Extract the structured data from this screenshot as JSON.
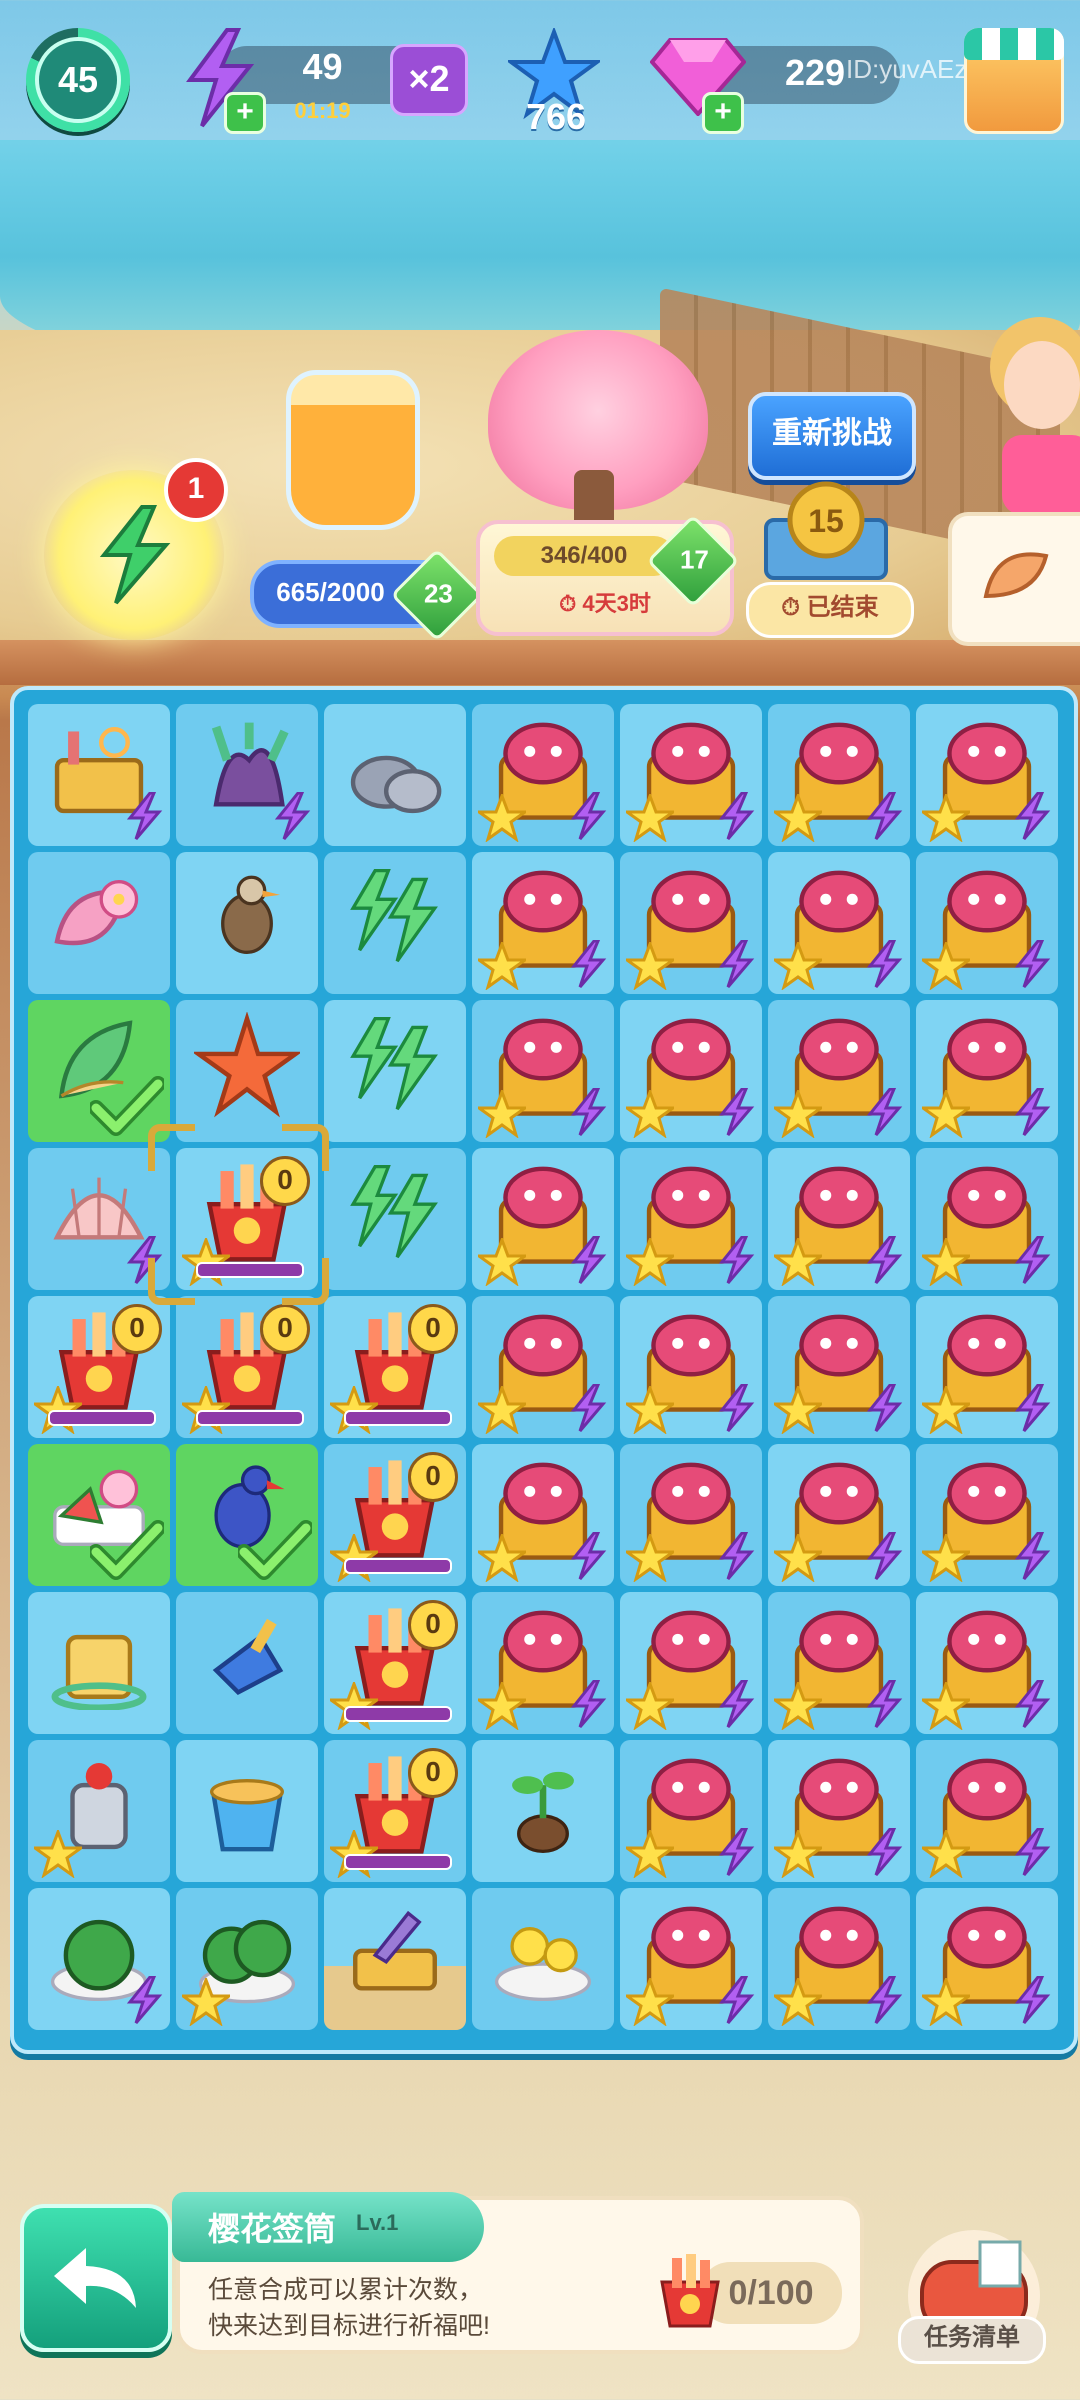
{
  "hud": {
    "level": "45",
    "energy_value": "49",
    "energy_timer": "01:19",
    "energy_multiplier": "×2",
    "stars": "766",
    "gems": "229",
    "user_id": "ID:yuvAEz"
  },
  "events": {
    "energy_badge": "1",
    "jar_progress": "665/2000",
    "jar_level": "23",
    "tree_progress": "346/400",
    "tree_level": "17",
    "tree_time": "⏱ 4天3时",
    "retry_label": "重新挑战",
    "coin_value": "15",
    "ended_label": "⏱ 已结束"
  },
  "board": {
    "zero_label": "0"
  },
  "info": {
    "item_name": "樱花签筒",
    "item_level": "Lv.1",
    "desc_line1": "任意合成可以累计次数，",
    "desc_line2": "快来达到目标进行祈福吧!",
    "count": "0/100",
    "task_label": "任务清单"
  },
  "colors": {
    "board": "#26a6d8",
    "cell": "#7fd4f3",
    "cell_done": "#5fd561",
    "accent_green": "#3ec14a",
    "retry_blue": "#1f6ed6"
  }
}
